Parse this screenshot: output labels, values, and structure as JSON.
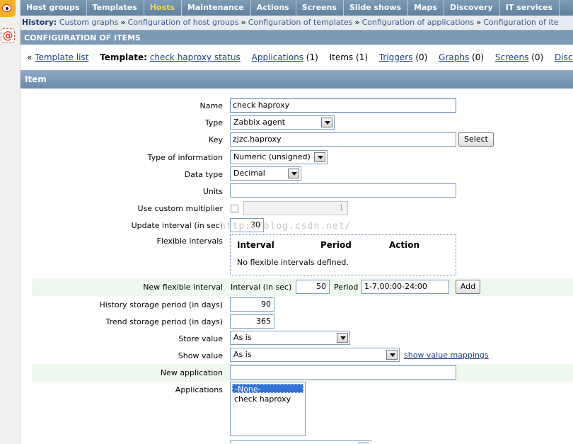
{
  "menu": [
    "Host groups",
    "Templates",
    "Hosts",
    "Maintenance",
    "Actions",
    "Screens",
    "Slide shows",
    "Maps",
    "Discovery",
    "IT services"
  ],
  "menu_selected": "Hosts",
  "history": {
    "label": "History:",
    "items": [
      "Custom graphs",
      "Configuration of host groups",
      "Configuration of templates",
      "Configuration of applications",
      "Configuration of ite"
    ],
    "separator": "»"
  },
  "config_title": "CONFIGURATION OF ITEMS",
  "template_bar": {
    "back_prefix": "«",
    "template_list": "Template list",
    "template_label": "Template:",
    "template_name": "check haproxy status",
    "applications": "Applications",
    "applications_count": "(1)",
    "items": "Items",
    "items_count": "(1)",
    "triggers": "Triggers",
    "triggers_count": "(0)",
    "graphs": "Graphs",
    "graphs_count": "(0)",
    "screens": "Screens",
    "screens_count": "(0)",
    "discovery": "Discovery"
  },
  "item_header": "Item",
  "form": {
    "name_label": "Name",
    "name_value": "check haproxy",
    "type_label": "Type",
    "type_value": "Zabbix agent",
    "key_label": "Key",
    "key_value": "zjzc.haproxy",
    "select_button": "Select",
    "info_label": "Type of information",
    "info_value": "Numeric (unsigned)",
    "datatype_label": "Data type",
    "datatype_value": "Decimal",
    "units_label": "Units",
    "units_value": "",
    "multiplier_label": "Use custom multiplier",
    "multiplier_value": "1",
    "interval_label": "Update interval (in sec)",
    "interval_value": "30",
    "flex_label": "Flexible intervals",
    "flex_col_interval": "Interval",
    "flex_col_period": "Period",
    "flex_col_action": "Action",
    "flex_empty": "No flexible intervals defined.",
    "newflex_label": "New flexible interval",
    "newflex_interval_label": "Interval (in sec)",
    "newflex_interval_value": "50",
    "newflex_period_label": "Period",
    "newflex_period_value": "1-7,00:00-24:00",
    "add_button": "Add",
    "history_label": "History storage period (in days)",
    "history_value": "90",
    "trend_label": "Trend storage period (in days)",
    "trend_value": "365",
    "store_label": "Store value",
    "store_value": "As is",
    "show_label": "Show value",
    "show_value": "As is",
    "show_mappings_link": "show value mappings",
    "newapp_label": "New application",
    "newapp_value": "",
    "apps_label": "Applications",
    "apps_options": [
      "-None-",
      "check haproxy"
    ]
  },
  "watermark": "http://blog.csdn.net/"
}
